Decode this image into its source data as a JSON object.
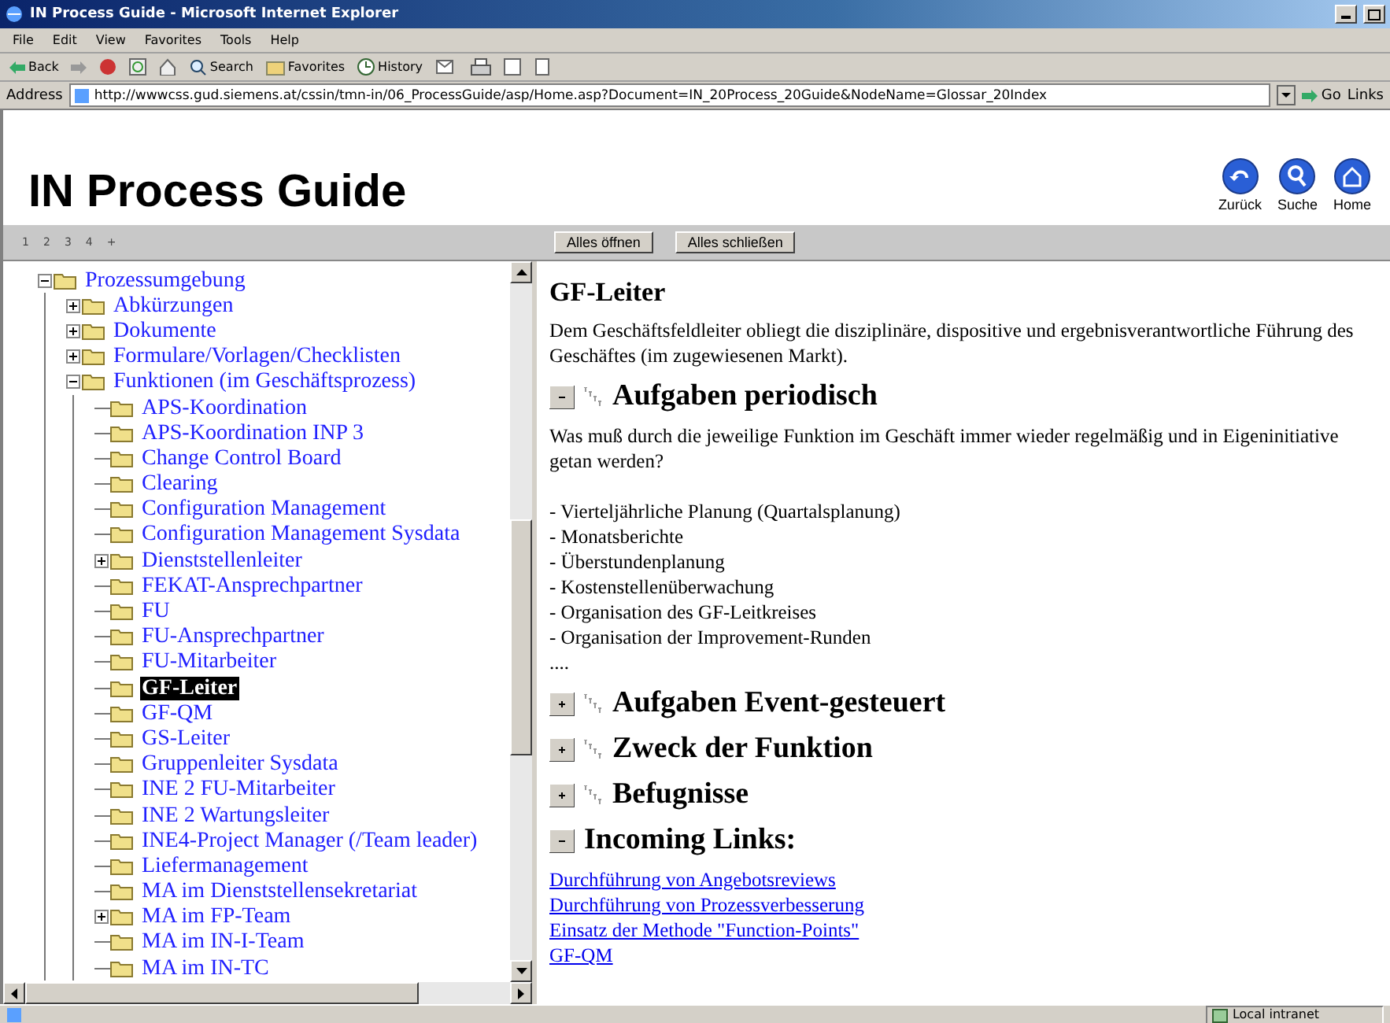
{
  "window": {
    "title": "IN Process Guide - Microsoft Internet Explorer"
  },
  "menu": [
    "File",
    "Edit",
    "View",
    "Favorites",
    "Tools",
    "Help"
  ],
  "toolbar": {
    "back": "Back",
    "search": "Search",
    "favorites": "Favorites",
    "history": "History"
  },
  "address": {
    "label": "Address",
    "url": "http://wwwcss.gud.siemens.at/cssin/tmn-in/06_ProcessGuide/asp/Home.asp?Document=IN_20Process_20Guide&NodeName=Glossar_20Index",
    "go": "Go",
    "links": "Links"
  },
  "header": {
    "title": "IN Process Guide",
    "nav": [
      "Zurück",
      "Suche",
      "Home"
    ]
  },
  "levels": [
    "1",
    "2",
    "3",
    "4",
    "+"
  ],
  "actions": [
    "Alles öffnen",
    "Alles schließen"
  ],
  "tree": [
    {
      "label": "Prozessumgebung",
      "selected": false,
      "expanded": true,
      "children": [
        {
          "label": "Abkürzungen",
          "selected": false,
          "expanded": false
        },
        {
          "label": "Dokumente",
          "selected": false,
          "expanded": false
        },
        {
          "label": "Formulare/Vorlagen/Checklisten",
          "selected": false,
          "expanded": false
        },
        {
          "label": "Funktionen (im Geschäftsprozess)",
          "selected": false,
          "expanded": true,
          "children": [
            {
              "label": "APS-Koordination",
              "selected": false
            },
            {
              "label": "APS-Koordination INP 3",
              "selected": false
            },
            {
              "label": "Change Control Board",
              "selected": false
            },
            {
              "label": "Clearing",
              "selected": false
            },
            {
              "label": "Configuration Management",
              "selected": false
            },
            {
              "label": "Configuration Management Sysdata",
              "selected": false
            },
            {
              "label": "Dienststellenleiter",
              "selected": false,
              "expanded": false
            },
            {
              "label": "FEKAT-Ansprechpartner",
              "selected": false
            },
            {
              "label": "FU",
              "selected": false
            },
            {
              "label": "FU-Ansprechpartner",
              "selected": false
            },
            {
              "label": "FU-Mitarbeiter",
              "selected": false
            },
            {
              "label": "GF-Leiter",
              "selected": true
            },
            {
              "label": "GF-QM",
              "selected": false
            },
            {
              "label": "GS-Leiter",
              "selected": false
            },
            {
              "label": "Gruppenleiter Sysdata",
              "selected": false
            },
            {
              "label": "INE 2 FU-Mitarbeiter",
              "selected": false
            },
            {
              "label": "INE 2 Wartungsleiter",
              "selected": false
            },
            {
              "label": "INE4-Project Manager (/Team leader)",
              "selected": false
            },
            {
              "label": "Liefermanagement",
              "selected": false
            },
            {
              "label": "MA im Dienststellensekretariat",
              "selected": false
            },
            {
              "label": "MA im FP-Team",
              "selected": false,
              "expanded": false
            },
            {
              "label": "MA im IN-I-Team",
              "selected": false
            },
            {
              "label": "MA im IN-TC",
              "selected": false
            }
          ]
        }
      ]
    }
  ],
  "content": {
    "title": "GF-Leiter",
    "intro": "Dem Geschäftsfeldleiter obliegt die disziplinäre, dispositive und ergebnisverantwortliche Führung des Geschäftes (im zugewiesenen Markt).",
    "sections": [
      {
        "kind": "section",
        "title": "Aufgaben periodisch",
        "expanded": true,
        "text": "Was muß durch die jeweilige Funktion im Geschäft immer wieder regelmäßig und in Eigeninitiative getan werden?",
        "items": [
          "- Vierteljährliche Planung (Quartalsplanung)",
          "- Monatsberichte",
          "- Überstundenplanung",
          "- Kostenstellenüberwachung",
          "- Organisation des GF-Leitkreises",
          "- Organisation der Improvement-Runden"
        ],
        "more": "...."
      },
      {
        "kind": "section",
        "title": "Aufgaben Event-gesteuert",
        "expanded": false
      },
      {
        "kind": "section",
        "title": "Zweck der Funktion",
        "expanded": false
      },
      {
        "kind": "section",
        "title": "Befugnisse",
        "expanded": false
      },
      {
        "kind": "links",
        "title": "Incoming Links:",
        "expanded": true,
        "links": [
          "Durchführung von Angebotsreviews",
          "Durchführung von Prozessverbesserung",
          "Einsatz der Methode \"Function-Points\"",
          "GF-QM"
        ]
      }
    ]
  },
  "status": {
    "zone": "Local intranet"
  }
}
